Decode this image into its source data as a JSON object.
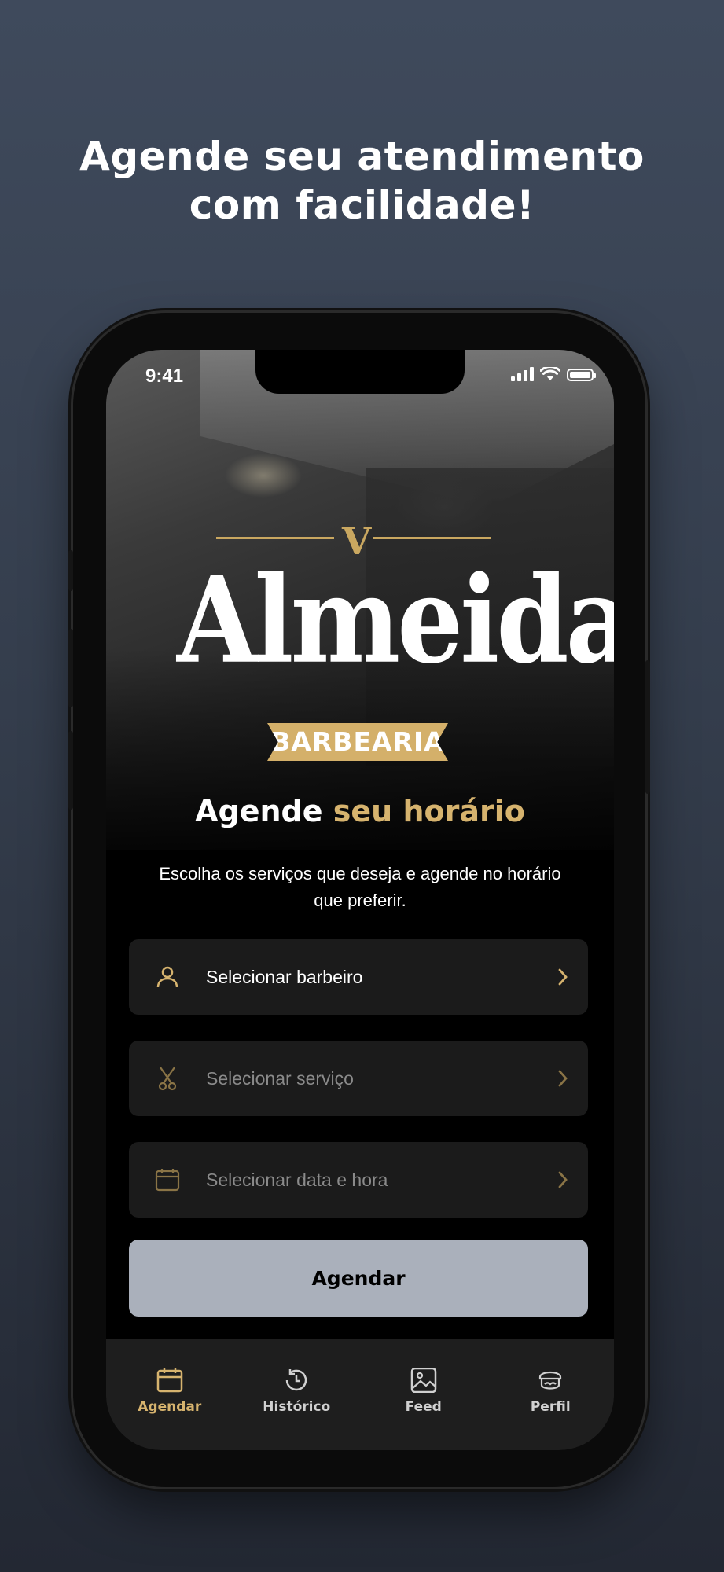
{
  "promo": {
    "line1": "Agende seu atendimento",
    "line2": "com facilidade!"
  },
  "status_bar": {
    "time": "9:41"
  },
  "logo": {
    "word": "Almeida",
    "banner": "BARBEARIA"
  },
  "hero": {
    "headline_part1": "Agende",
    "headline_part2": "seu horário",
    "subtitle": "Escolha os serviços que deseja e  agende no horário que preferir."
  },
  "form": {
    "barber_label": "Selecionar barbeiro",
    "service_label": "Selecionar serviço",
    "datetime_label": "Selecionar data e hora",
    "submit_label": "Agendar"
  },
  "tabs": [
    {
      "label": "Agendar",
      "icon": "calendar-icon",
      "active": true
    },
    {
      "label": "Histórico",
      "icon": "history-icon",
      "active": false
    },
    {
      "label": "Feed",
      "icon": "image-icon",
      "active": false
    },
    {
      "label": "Perfil",
      "icon": "barber-profile-icon",
      "active": false
    }
  ],
  "colors": {
    "accent": "#d6b36e",
    "button_bg": "#aab0bb",
    "row_bg": "#1b1b1b",
    "tabbar_bg": "#1e1e1e"
  }
}
